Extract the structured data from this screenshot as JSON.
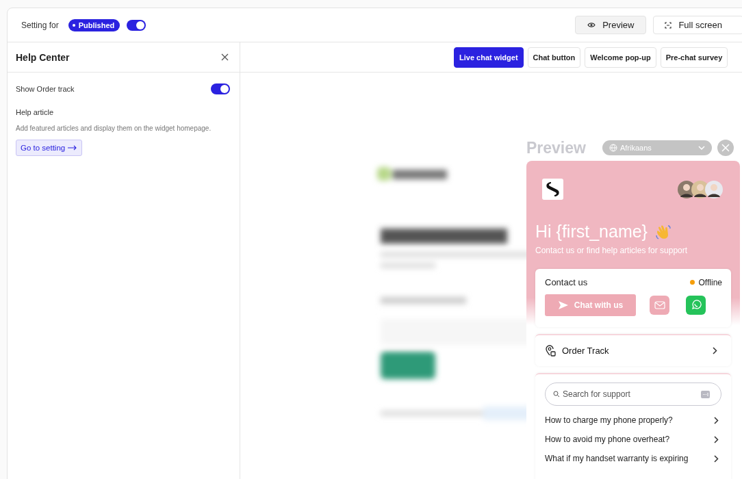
{
  "top_bar": {
    "setting_label": "Setting for",
    "status_badge": "Published",
    "publish_toggle": {
      "on": true
    },
    "buttons": [
      {
        "kind": "preview",
        "label": "Preview"
      },
      {
        "kind": "fullscreen",
        "label": "Full screen"
      }
    ]
  },
  "panel": {
    "title": "Help Center",
    "order_track_toggle": {
      "label": "Show Order track",
      "on": true
    },
    "section_title": "Help article",
    "description": "Add featured articles and display them on the widget homepage.",
    "link_button": "Go to setting"
  },
  "tabs": [
    {
      "label": "Live chat widget",
      "selected": true
    },
    {
      "label": "Chat button",
      "selected": false
    },
    {
      "label": "Welcome pop-up",
      "selected": false
    },
    {
      "label": "Pre-chat survey",
      "selected": false
    }
  ],
  "preview": {
    "title": "Preview",
    "language": "Afrikaans"
  },
  "widget": {
    "greeting": "Hi {first_name}",
    "subtitle": "Contact us or find help articles for support",
    "contact": {
      "title": "Contact us",
      "status": "Offline",
      "chat_button": "Chat with us"
    },
    "order_track": "Order Track",
    "search": {
      "placeholder": "Search for support"
    },
    "articles": [
      "How to charge my phone properly?",
      "How to avoid my phone overheat?",
      "What if my handset warranty is expiring"
    ]
  }
}
